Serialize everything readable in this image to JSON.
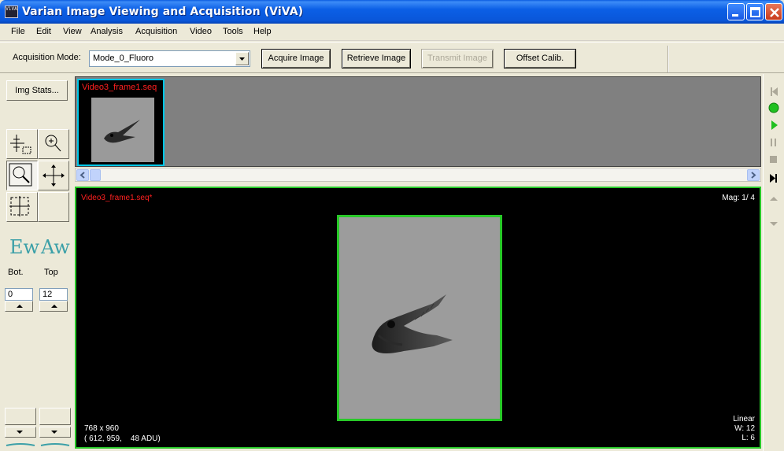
{
  "window": {
    "title": "Varian Image Viewing and Acquisition (ViVA)",
    "app_icon_text": "ViVA"
  },
  "menu": [
    "File",
    "Edit",
    "View",
    "Analysis",
    "Acquisition",
    "Video",
    "Tools",
    "Help"
  ],
  "toolbar": {
    "acq_mode_label": "Acquisition Mode:",
    "acq_mode_value": "Mode_0_Fluoro",
    "acquire_label": "Acquire Image",
    "retrieve_label": "Retrieve Image",
    "transmit_label": "Transmit Image",
    "offset_label": "Offset Calib."
  },
  "left": {
    "img_stats_label": "Img Stats...",
    "bot_label": "Bot.",
    "top_label": "Top",
    "bot_value": "0",
    "top_value": "12",
    "ew_label": "Ew",
    "aw_label": "Aw"
  },
  "thumbnails": [
    {
      "label": "Video3_frame1.seq"
    }
  ],
  "viewer": {
    "filename": "Video3_frame1.seq*",
    "mag": "Mag: 1/ 4",
    "dimensions": "768 x 960",
    "coords": "( 612, 959,    48 ADU)",
    "lut": "Linear",
    "window": "W: 12",
    "level": "L: 6"
  },
  "colors": {
    "viewer_border": "#28c828",
    "thumb_selected_border": "#00c8e8",
    "overlay_filename": "#ff2020",
    "titlebar": "#0a56d8"
  },
  "video_controls": [
    "first-frame-icon",
    "record-icon",
    "play-icon",
    "pause-icon",
    "stop-icon",
    "last-frame-icon",
    "scroll-up-icon",
    "scroll-down-icon"
  ]
}
